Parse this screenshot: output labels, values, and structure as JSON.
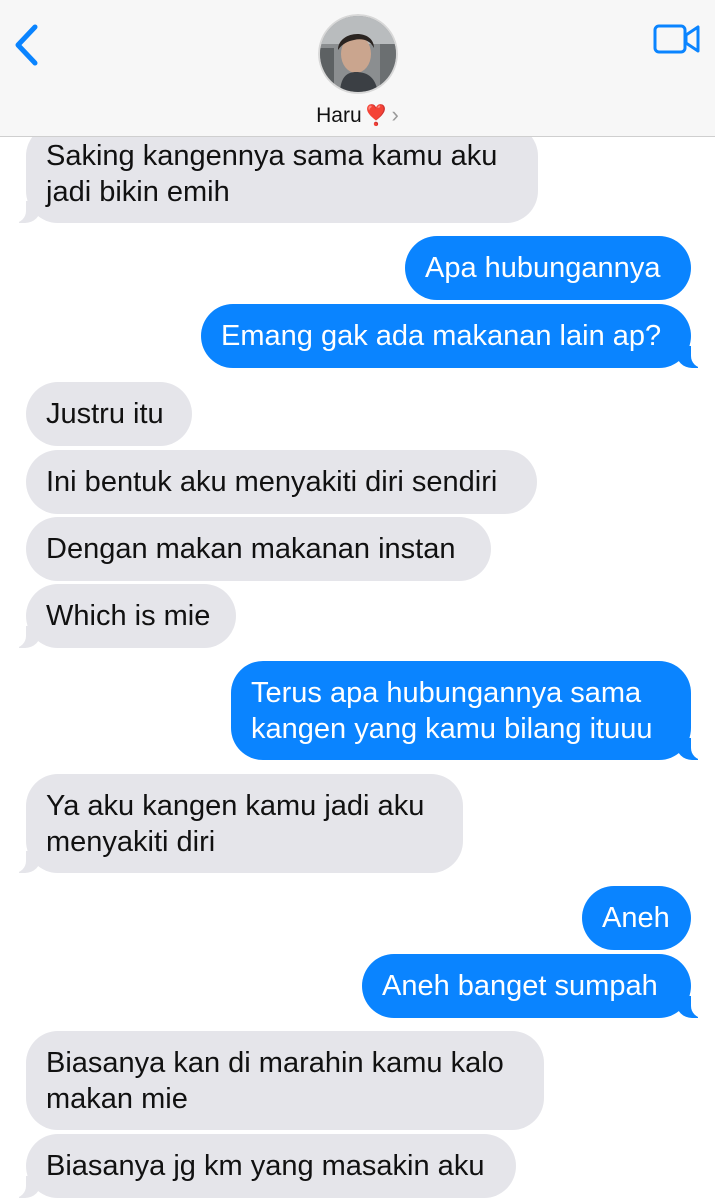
{
  "header": {
    "contact_name": "Haru",
    "heart_glyph": "❣️",
    "chevron_glyph": "›",
    "back_icon": "chevron-left-icon",
    "video_icon": "video-camera-icon",
    "accent_color": "#0a84ff"
  },
  "messages": [
    {
      "direction": "incoming",
      "text": "Saking kangennya sama kamu aku jadi bikin emih"
    },
    {
      "direction": "outgoing",
      "text": "Apa hubungannya"
    },
    {
      "direction": "outgoing",
      "text": "Emang gak ada makanan lain ap?"
    },
    {
      "direction": "incoming",
      "text": "Justru itu"
    },
    {
      "direction": "incoming",
      "text": "Ini bentuk aku menyakiti diri sendiri"
    },
    {
      "direction": "incoming",
      "text": "Dengan makan makanan instan"
    },
    {
      "direction": "incoming",
      "text": "Which is mie"
    },
    {
      "direction": "outgoing",
      "text": "Terus apa hubungannya sama kangen yang kamu bilang ituuu"
    },
    {
      "direction": "incoming",
      "text": "Ya aku kangen kamu jadi aku menyakiti diri"
    },
    {
      "direction": "outgoing",
      "text": "Aneh"
    },
    {
      "direction": "outgoing",
      "text": "Aneh banget sumpah"
    },
    {
      "direction": "incoming",
      "text": "Biasanya kan di marahin kamu kalo makan mie"
    },
    {
      "direction": "incoming",
      "text": "Biasanya jg km yang masakin aku"
    }
  ]
}
